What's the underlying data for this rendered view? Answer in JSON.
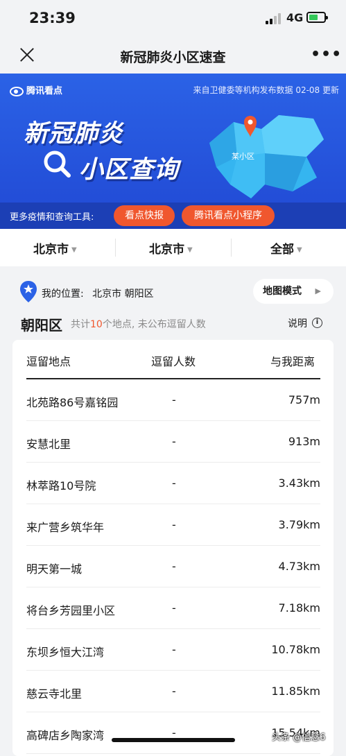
{
  "status": {
    "time": "23:39",
    "network": "4G"
  },
  "nav": {
    "title": "新冠肺炎小区速查"
  },
  "banner": {
    "brand": "腾讯看点",
    "source": "来自卫健委等机构发布数据 02-08 更新",
    "title_line1": "新冠肺炎",
    "title_line2": "小区查询",
    "map_label": "某小区",
    "tools_label": "更多疫情和查询工具:",
    "tool_buttons": [
      "看点快报",
      "腾讯看点小程序"
    ],
    "colors": {
      "primary": "#2b62e6",
      "accent": "#f0572e"
    }
  },
  "filters": [
    "北京市",
    "北京市",
    "全部"
  ],
  "location": {
    "label": "我的位置:",
    "value": "北京市 朝阳区",
    "map_button": "地图模式"
  },
  "district": {
    "name": "朝阳区",
    "prefix": "共计",
    "count": "10",
    "suffix": "个地点, 未公布逗留人数",
    "explain": "说明"
  },
  "table": {
    "headers": [
      "逗留地点",
      "逗留人数",
      "与我距离"
    ],
    "rows": [
      [
        "北苑路86号嘉铭园",
        "-",
        "757m"
      ],
      [
        "安慧北里",
        "-",
        "913m"
      ],
      [
        "林萃路10号院",
        "-",
        "3.43km"
      ],
      [
        "来广营乡筑华年",
        "-",
        "3.79km"
      ],
      [
        "明天第一城",
        "-",
        "4.73km"
      ],
      [
        "将台乡芳园里小区",
        "-",
        "7.18km"
      ],
      [
        "东坝乡恒大江湾",
        "-",
        "10.78km"
      ],
      [
        "慈云寺北里",
        "-",
        "11.85km"
      ],
      [
        "高碑店乡陶家湾",
        "-",
        "15.54km"
      ]
    ]
  },
  "watermark": "头条 @信念6"
}
